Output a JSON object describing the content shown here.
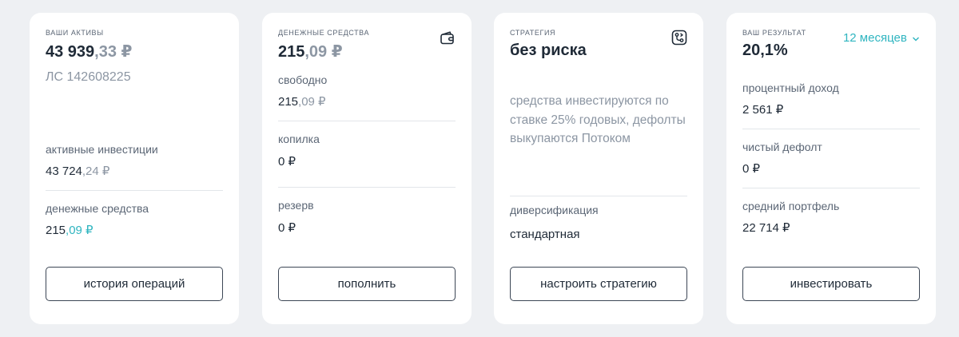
{
  "assets": {
    "caption": "ВАШИ АКТИВЫ",
    "total_main": "43 939",
    "total_fraction": ",33 ₽",
    "account": "ЛС 142608225",
    "active_label": "активные инвестиции",
    "active_main": "43 724",
    "active_fraction": ",24 ₽",
    "cash_label": "денежные средства",
    "cash_main": "215",
    "cash_fraction": ",09 ₽",
    "button": "история операций"
  },
  "cash": {
    "caption": "ДЕНЕЖНЫЕ СРЕДСТВА",
    "icon": "wallet-icon",
    "total_main": "215",
    "total_fraction": ",09 ₽",
    "free_label": "свободно",
    "free_main": "215",
    "free_fraction": ",09 ₽",
    "piggy_label": "копилка",
    "piggy_value": "0 ₽",
    "reserve_label": "резерв",
    "reserve_value": "0 ₽",
    "button": "пополнить"
  },
  "strategy": {
    "caption": "СТРАТЕГИЯ",
    "icon": "strategy-icon",
    "name": "без риска",
    "description": "средства инвестируются по ставке 25% годовых, дефолты выкупаются Потоком",
    "diversification_label": "диверсификация",
    "diversification_value": "стандартная",
    "button": "настроить стратегию"
  },
  "result": {
    "caption": "ВАШ РЕЗУЛЬТАТ",
    "period": "12 месяцев",
    "value": "20,1%",
    "interest_label": "процентный доход",
    "interest_value": "2 561 ₽",
    "default_label": "чистый дефолт",
    "default_value": "0 ₽",
    "portfolio_label": "средний портфель",
    "portfolio_value": "22 714 ₽",
    "button": "инвестировать"
  },
  "colors": {
    "accent": "#2fb5c0",
    "text": "#1f2a37",
    "muted": "#8c96a3",
    "background": "#eef0f3"
  }
}
